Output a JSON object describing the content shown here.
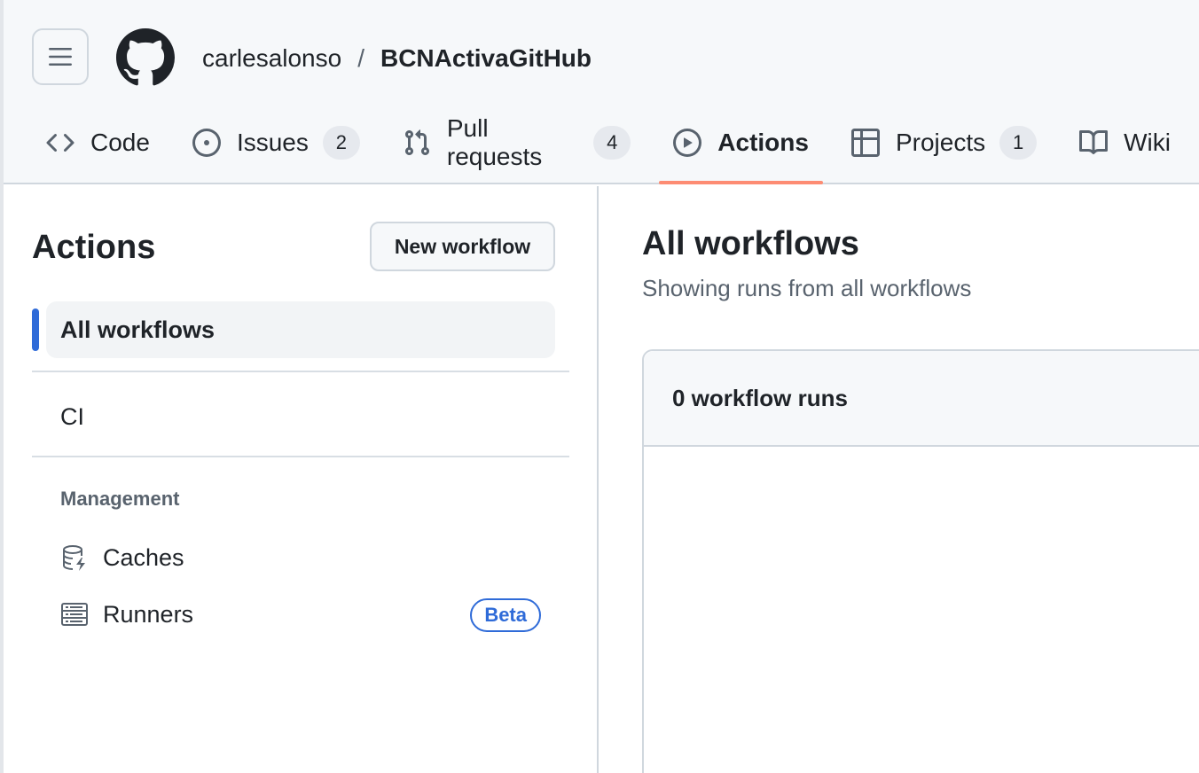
{
  "header": {
    "owner": "carlesalonso",
    "separator": "/",
    "repo": "BCNActivaGitHub"
  },
  "tabs": [
    {
      "label": "Code",
      "icon": "code-icon"
    },
    {
      "label": "Issues",
      "icon": "issue-opened-icon",
      "count": "2"
    },
    {
      "label": "Pull requests",
      "icon": "git-pull-request-icon",
      "count": "4"
    },
    {
      "label": "Actions",
      "icon": "play-icon",
      "selected": true
    },
    {
      "label": "Projects",
      "icon": "table-icon",
      "count": "1"
    },
    {
      "label": "Wiki",
      "icon": "book-icon"
    }
  ],
  "sidebar": {
    "title": "Actions",
    "new_workflow_label": "New workflow",
    "all_workflows_label": "All workflows",
    "workflows": [
      {
        "label": "CI"
      }
    ],
    "management_label": "Management",
    "management_items": [
      {
        "label": "Caches",
        "icon": "database-icon"
      },
      {
        "label": "Runners",
        "icon": "server-icon",
        "badge": "Beta"
      }
    ]
  },
  "main": {
    "title": "All workflows",
    "subtitle": "Showing runs from all workflows",
    "runs_count_label": "0 workflow runs"
  },
  "colors": {
    "accent_underline": "#fd8c73",
    "active_indicator": "#2f6bd8",
    "header_bg": "#f6f8fa",
    "beta_badge": "#2f6bd8"
  }
}
